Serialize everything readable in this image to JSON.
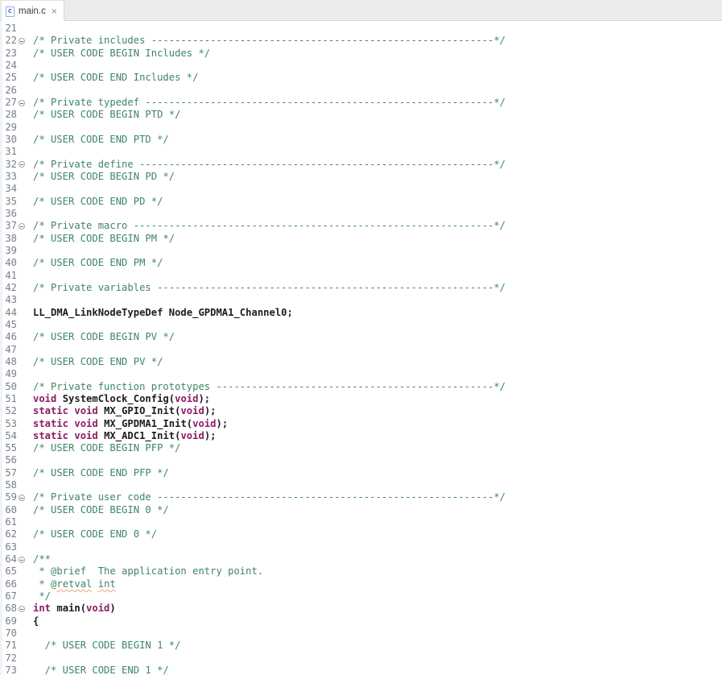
{
  "tab": {
    "title": "main.c",
    "close_glyph": "×",
    "file_icon_letter": "c"
  },
  "colors": {
    "comment": "#3F8565",
    "keyword": "#8E1A65",
    "code": "#1c1c1c",
    "line_number": "#75808E",
    "warn_underline": "#F0A472",
    "tab_bar_bg": "#ECECEC",
    "border": "#D6D6D6"
  },
  "editor": {
    "first_line": 21,
    "last_line": 73,
    "lines": [
      {
        "n": 21,
        "fold": false,
        "seg": []
      },
      {
        "n": 22,
        "fold": true,
        "seg": [
          {
            "s": "cmt",
            "t": "/* Private includes ----------------------------------------------------------*/"
          }
        ]
      },
      {
        "n": 23,
        "fold": false,
        "seg": [
          {
            "s": "cmt",
            "t": "/* USER CODE BEGIN Includes */"
          }
        ]
      },
      {
        "n": 24,
        "fold": false,
        "seg": []
      },
      {
        "n": 25,
        "fold": false,
        "seg": [
          {
            "s": "cmt",
            "t": "/* USER CODE END Includes */"
          }
        ]
      },
      {
        "n": 26,
        "fold": false,
        "seg": []
      },
      {
        "n": 27,
        "fold": true,
        "seg": [
          {
            "s": "cmt",
            "t": "/* Private typedef -----------------------------------------------------------*/"
          }
        ]
      },
      {
        "n": 28,
        "fold": false,
        "seg": [
          {
            "s": "cmt",
            "t": "/* USER CODE BEGIN PTD */"
          }
        ]
      },
      {
        "n": 29,
        "fold": false,
        "seg": []
      },
      {
        "n": 30,
        "fold": false,
        "seg": [
          {
            "s": "cmt",
            "t": "/* USER CODE END PTD */"
          }
        ]
      },
      {
        "n": 31,
        "fold": false,
        "seg": []
      },
      {
        "n": 32,
        "fold": true,
        "seg": [
          {
            "s": "cmt",
            "t": "/* Private define ------------------------------------------------------------*/"
          }
        ]
      },
      {
        "n": 33,
        "fold": false,
        "seg": [
          {
            "s": "cmt",
            "t": "/* USER CODE BEGIN PD */"
          }
        ]
      },
      {
        "n": 34,
        "fold": false,
        "seg": []
      },
      {
        "n": 35,
        "fold": false,
        "seg": [
          {
            "s": "cmt",
            "t": "/* USER CODE END PD */"
          }
        ]
      },
      {
        "n": 36,
        "fold": false,
        "seg": []
      },
      {
        "n": 37,
        "fold": true,
        "seg": [
          {
            "s": "cmt",
            "t": "/* Private macro -------------------------------------------------------------*/"
          }
        ]
      },
      {
        "n": 38,
        "fold": false,
        "seg": [
          {
            "s": "cmt",
            "t": "/* USER CODE BEGIN PM */"
          }
        ]
      },
      {
        "n": 39,
        "fold": false,
        "seg": []
      },
      {
        "n": 40,
        "fold": false,
        "seg": [
          {
            "s": "cmt",
            "t": "/* USER CODE END PM */"
          }
        ]
      },
      {
        "n": 41,
        "fold": false,
        "seg": []
      },
      {
        "n": 42,
        "fold": false,
        "seg": [
          {
            "s": "cmt",
            "t": "/* Private variables ---------------------------------------------------------*/"
          }
        ]
      },
      {
        "n": 43,
        "fold": false,
        "seg": []
      },
      {
        "n": 44,
        "fold": false,
        "seg": [
          {
            "s": "id",
            "t": "LL_DMA_LinkNodeTypeDef Node_GPDMA1_Channel0;"
          }
        ]
      },
      {
        "n": 45,
        "fold": false,
        "seg": []
      },
      {
        "n": 46,
        "fold": false,
        "seg": [
          {
            "s": "cmt",
            "t": "/* USER CODE BEGIN PV */"
          }
        ]
      },
      {
        "n": 47,
        "fold": false,
        "seg": []
      },
      {
        "n": 48,
        "fold": false,
        "seg": [
          {
            "s": "cmt",
            "t": "/* USER CODE END PV */"
          }
        ]
      },
      {
        "n": 49,
        "fold": false,
        "seg": []
      },
      {
        "n": 50,
        "fold": false,
        "seg": [
          {
            "s": "cmt",
            "t": "/* Private function prototypes -----------------------------------------------*/"
          }
        ]
      },
      {
        "n": 51,
        "fold": false,
        "seg": [
          {
            "s": "kw",
            "t": "void"
          },
          {
            "s": "id",
            "t": " SystemClock_Config("
          },
          {
            "s": "kw",
            "t": "void"
          },
          {
            "s": "id",
            "t": ");"
          }
        ]
      },
      {
        "n": 52,
        "fold": false,
        "seg": [
          {
            "s": "kw",
            "t": "static"
          },
          {
            "s": "id",
            "t": " "
          },
          {
            "s": "kw",
            "t": "void"
          },
          {
            "s": "id",
            "t": " MX_GPIO_Init("
          },
          {
            "s": "kw",
            "t": "void"
          },
          {
            "s": "id",
            "t": ");"
          }
        ]
      },
      {
        "n": 53,
        "fold": false,
        "seg": [
          {
            "s": "kw",
            "t": "static"
          },
          {
            "s": "id",
            "t": " "
          },
          {
            "s": "kw",
            "t": "void"
          },
          {
            "s": "id",
            "t": " MX_GPDMA1_Init("
          },
          {
            "s": "kw",
            "t": "void"
          },
          {
            "s": "id",
            "t": ");"
          }
        ]
      },
      {
        "n": 54,
        "fold": false,
        "seg": [
          {
            "s": "kw",
            "t": "static"
          },
          {
            "s": "id",
            "t": " "
          },
          {
            "s": "kw",
            "t": "void"
          },
          {
            "s": "id",
            "t": " MX_ADC1_Init("
          },
          {
            "s": "kw",
            "t": "void"
          },
          {
            "s": "id",
            "t": ");"
          }
        ]
      },
      {
        "n": 55,
        "fold": false,
        "seg": [
          {
            "s": "cmt",
            "t": "/* USER CODE BEGIN PFP */"
          }
        ]
      },
      {
        "n": 56,
        "fold": false,
        "seg": []
      },
      {
        "n": 57,
        "fold": false,
        "seg": [
          {
            "s": "cmt",
            "t": "/* USER CODE END PFP */"
          }
        ]
      },
      {
        "n": 58,
        "fold": false,
        "seg": []
      },
      {
        "n": 59,
        "fold": true,
        "seg": [
          {
            "s": "cmt",
            "t": "/* Private user code ---------------------------------------------------------*/"
          }
        ]
      },
      {
        "n": 60,
        "fold": false,
        "seg": [
          {
            "s": "cmt",
            "t": "/* USER CODE BEGIN 0 */"
          }
        ]
      },
      {
        "n": 61,
        "fold": false,
        "seg": []
      },
      {
        "n": 62,
        "fold": false,
        "seg": [
          {
            "s": "cmt",
            "t": "/* USER CODE END 0 */"
          }
        ]
      },
      {
        "n": 63,
        "fold": false,
        "seg": []
      },
      {
        "n": 64,
        "fold": true,
        "seg": [
          {
            "s": "cmt",
            "t": "/**"
          }
        ]
      },
      {
        "n": 65,
        "fold": false,
        "seg": [
          {
            "s": "cmt",
            "t": " * @brief  The application entry point."
          }
        ]
      },
      {
        "n": 66,
        "fold": false,
        "seg": [
          {
            "s": "cmt",
            "t": " * @"
          },
          {
            "s": "warn",
            "t": "retval"
          },
          {
            "s": "cmt",
            "t": " "
          },
          {
            "s": "warn",
            "t": "int"
          }
        ]
      },
      {
        "n": 67,
        "fold": false,
        "seg": [
          {
            "s": "cmt",
            "t": " */"
          }
        ]
      },
      {
        "n": 68,
        "fold": true,
        "seg": [
          {
            "s": "kw",
            "t": "int"
          },
          {
            "s": "id",
            "t": " main("
          },
          {
            "s": "kw",
            "t": "void"
          },
          {
            "s": "id",
            "t": ")"
          }
        ]
      },
      {
        "n": 69,
        "fold": false,
        "seg": [
          {
            "s": "id",
            "t": "{"
          }
        ]
      },
      {
        "n": 70,
        "fold": false,
        "seg": []
      },
      {
        "n": 71,
        "fold": false,
        "seg": [
          {
            "s": "cmt",
            "t": "  /* USER CODE BEGIN 1 */"
          }
        ]
      },
      {
        "n": 72,
        "fold": false,
        "seg": []
      },
      {
        "n": 73,
        "fold": false,
        "seg": [
          {
            "s": "cmt",
            "t": "  /* USER CODE END 1 */"
          }
        ]
      }
    ]
  }
}
